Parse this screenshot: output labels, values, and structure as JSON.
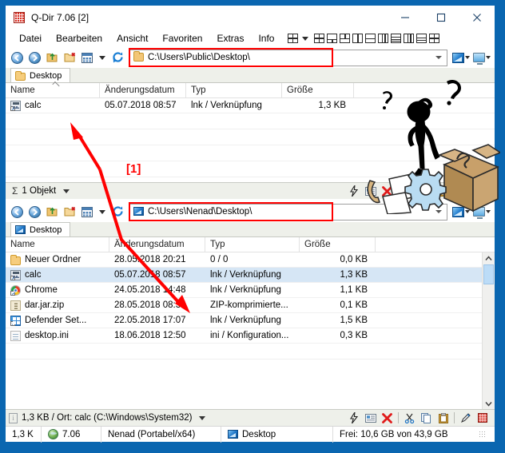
{
  "window": {
    "title": "Q-Dir 7.06 [2]",
    "title_icon": "qdir-app-icon",
    "buttons": {
      "minimize": "minimize-icon",
      "maximize": "maximize-icon",
      "close": "close-icon"
    }
  },
  "menubar": {
    "items": [
      "Datei",
      "Bearbeiten",
      "Ansicht",
      "Favoriten",
      "Extras",
      "Info"
    ],
    "layout_icons": [
      "layout-quad",
      "layout-dropdown-caret",
      "layout-quad-2",
      "layout-3-bottom",
      "layout-3-top",
      "layout-2-vertical",
      "layout-2-horizontal",
      "layout-3-columns",
      "layout-1-pane",
      "layout-3-cols-alt",
      "layout-rows",
      "layout-quad-alt"
    ]
  },
  "panes": [
    {
      "id": "pane-top",
      "address": {
        "value": "C:\\Users\\Public\\Desktop\\",
        "icon": "folder-icon",
        "highlighted": true,
        "highlight_color": "#ff0000"
      },
      "toolbar": {
        "back": "back-arrow-icon",
        "forward": "forward-arrow-icon",
        "up": "up-folder-icon",
        "new_folder": "new-folder-icon",
        "views": "views-grid-icon",
        "views_caret": "chevron-down-icon",
        "refresh": "refresh-icon",
        "monitor_1": "screen-icon",
        "monitor_1_caret": "chevron-down-icon",
        "monitor_2": "display-icon",
        "monitor_2_caret": "chevron-down-icon"
      },
      "tab": {
        "label": "Desktop",
        "icon": "folder-icon"
      },
      "columns": [
        {
          "label": "Name",
          "sorted": "asc"
        },
        {
          "label": "Änderungsdatum"
        },
        {
          "label": "Typ"
        },
        {
          "label": "Größe"
        }
      ],
      "rows": [
        {
          "icon": "calc-shortcut-icon",
          "name": "calc",
          "date": "05.07.2018 08:57",
          "type": "lnk / Verknüpfung",
          "size": "1,3 KB",
          "selected": false
        }
      ],
      "status": {
        "summary": "1 Objekt",
        "sigma": "Σ",
        "caret": "chevron-down-icon",
        "icons": [
          "lightning-icon",
          "rename-icon",
          "delete-icon",
          "cut-icon",
          "copy-icon",
          "paste-icon",
          "edit-icon",
          "grid-icon"
        ]
      }
    },
    {
      "id": "pane-bottom",
      "address": {
        "value": "C:\\Users\\Nenad\\Desktop\\",
        "icon": "screen-icon",
        "highlighted": true,
        "highlight_color": "#ff0000"
      },
      "toolbar": {
        "back": "back-arrow-icon",
        "forward": "forward-arrow-icon",
        "up": "up-folder-icon",
        "new_folder": "new-folder-icon",
        "views": "views-grid-icon",
        "views_caret": "chevron-down-icon",
        "refresh": "refresh-icon",
        "monitor_1": "screen-icon",
        "monitor_1_caret": "chevron-down-icon",
        "monitor_2": "display-icon",
        "monitor_2_caret": "chevron-down-icon"
      },
      "tab": {
        "label": "Desktop",
        "icon": "screen-icon"
      },
      "columns": [
        {
          "label": "Name"
        },
        {
          "label": "Änderungsdatum"
        },
        {
          "label": "Typ"
        },
        {
          "label": "Größe"
        }
      ],
      "rows": [
        {
          "icon": "folder-icon",
          "name": "Neuer Ordner",
          "date": "28.05.2018 20:21",
          "type": "0 / 0",
          "size": "0,0 KB",
          "selected": false
        },
        {
          "icon": "calc-shortcut-icon",
          "name": "calc",
          "date": "05.07.2018 08:57",
          "type": "lnk / Verknüpfung",
          "size": "1,3 KB",
          "selected": true
        },
        {
          "icon": "chrome-shortcut-icon",
          "name": "Chrome",
          "date": "24.05.2018 14:48",
          "type": "lnk / Verknüpfung",
          "size": "1,1 KB",
          "selected": false
        },
        {
          "icon": "zip-icon",
          "name": "dar.jar.zip",
          "date": "28.05.2018 08:35",
          "type": "ZIP-komprimierte...",
          "size": "0,1 KB",
          "selected": false
        },
        {
          "icon": "defender-shortcut-icon",
          "name": "Defender Set...",
          "date": "22.05.2018 17:07",
          "type": "lnk / Verknüpfung",
          "size": "1,5 KB",
          "selected": false
        },
        {
          "icon": "ini-file-icon",
          "name": "desktop.ini",
          "date": "18.06.2018 12:50",
          "type": "ini / Konfiguration...",
          "size": "0,3 KB",
          "selected": false
        }
      ],
      "scrollbar": {
        "up": "scroll-up-icon",
        "down": "scroll-down-icon",
        "thumb": "scroll-thumb"
      },
      "status": {
        "summary": "1,3 KB / Ort: calc (C:\\Windows\\System32)",
        "info_glyph": "i",
        "caret": "chevron-down-icon",
        "icons": [
          "lightning-icon",
          "rename-icon",
          "delete-icon",
          "cut-icon",
          "copy-icon",
          "paste-icon",
          "edit-icon",
          "grid-icon"
        ]
      }
    }
  ],
  "window_status": {
    "size": "1,3 K",
    "version": "7.06",
    "version_icon": "globe-icon",
    "user": "Nenad (Portabel/x64)",
    "location": "Desktop",
    "location_icon": "screen-icon",
    "free_space": "Frei: 10,6 GB von 43,9 GB",
    "resize_grip": "resize-grip-icon"
  },
  "annotation": {
    "label": "[1]",
    "color": "#ff0000",
    "arrow_name": "red-annotation-arrow"
  },
  "artwork": {
    "name": "confused-person-box-illustration",
    "elements": [
      "question-mark-large",
      "question-mark-small",
      "stick-figure",
      "cardboard-box",
      "gear",
      "papers",
      "hook"
    ]
  },
  "colors": {
    "window_frame": "#0a66b0",
    "accent_red": "#ff0000",
    "selection": "#d6e6f5",
    "status_bg": "#eef0ea"
  }
}
